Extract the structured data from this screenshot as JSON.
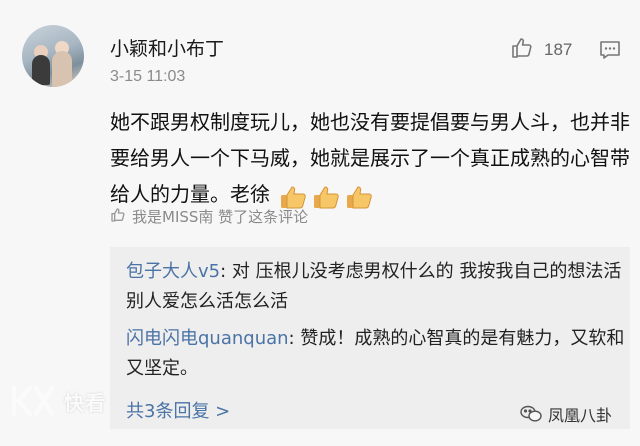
{
  "comment": {
    "username": "小颖和小布丁",
    "timestamp": "3-15 11:03",
    "like_count": "187",
    "body": "她不跟男权制度玩儿，她也没有要提倡要与男人斗，也并非要给男人一个下马威，她就是展示了一个真正成熟的心智带给人的力量。老徐",
    "trailing_emoji": [
      "thumbs-up",
      "thumbs-up",
      "thumbs-up"
    ],
    "liked_by_text": "我是MISS南 赞了这条评论"
  },
  "replies": [
    {
      "author": "包子大人v5",
      "text": ": 对 压根儿没考虑男权什么的 我按我自己的想法活 别人爱怎么活怎么活"
    },
    {
      "author": "闪电闪电quanquan",
      "text": ": 赞成！成熟的心智真的是有魅力，又软和又坚定。"
    }
  ],
  "more_replies_label": "共3条回复 >",
  "watermarks": {
    "left": "快看",
    "right": "凤凰八卦"
  },
  "colors": {
    "link_blue": "#4a73a6",
    "meta_gray": "#8a8a8a",
    "reply_bg": "#eeeeee",
    "page_bg": "#f7f7f7"
  }
}
